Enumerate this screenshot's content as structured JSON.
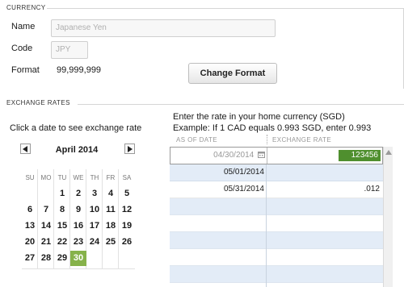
{
  "currency": {
    "section_title": "CURRENCY",
    "name_label": "Name",
    "name_placeholder": "Japanese Yen",
    "code_label": "Code",
    "code_placeholder": "JPY",
    "format_label": "Format",
    "format_value": "99,999,999",
    "change_format_button": "Change Format"
  },
  "exchange": {
    "section_title": "EXCHANGE RATES",
    "click_hint": "Click a date to see exchange rate",
    "instruction_line1": "Enter the rate in your home currency (SGD)",
    "instruction_line2": "Example: If 1 CAD equals 0.993 SGD, enter 0.993",
    "col_as_of_date": "AS OF DATE",
    "col_exchange_rate": "EXCHANGE RATE",
    "rows": [
      {
        "date": "04/30/2014",
        "rate": "123456"
      },
      {
        "date": "05/01/2014",
        "rate": ""
      },
      {
        "date": "05/31/2014",
        "rate": ".012"
      }
    ]
  },
  "calendar": {
    "month_label": "April 2014",
    "prev_icon": "triangle-left-icon",
    "next_icon": "triangle-right-icon",
    "weekdays": [
      "SU",
      "MO",
      "TU",
      "WE",
      "TH",
      "FR",
      "SA"
    ],
    "weeks": [
      [
        "",
        "",
        "1",
        "2",
        "3",
        "4",
        "5"
      ],
      [
        "6",
        "7",
        "8",
        "9",
        "10",
        "11",
        "12"
      ],
      [
        "13",
        "14",
        "15",
        "16",
        "17",
        "18",
        "19"
      ],
      [
        "20",
        "21",
        "22",
        "23",
        "24",
        "25",
        "26"
      ],
      [
        "27",
        "28",
        "29",
        "30",
        "",
        "",
        ""
      ]
    ],
    "selected_day": "30"
  },
  "colors": {
    "selected_day_bg": "#86b24a",
    "selected_rate_bg": "#4f8f2e",
    "stripe_row_bg": "#e3ecf7"
  }
}
